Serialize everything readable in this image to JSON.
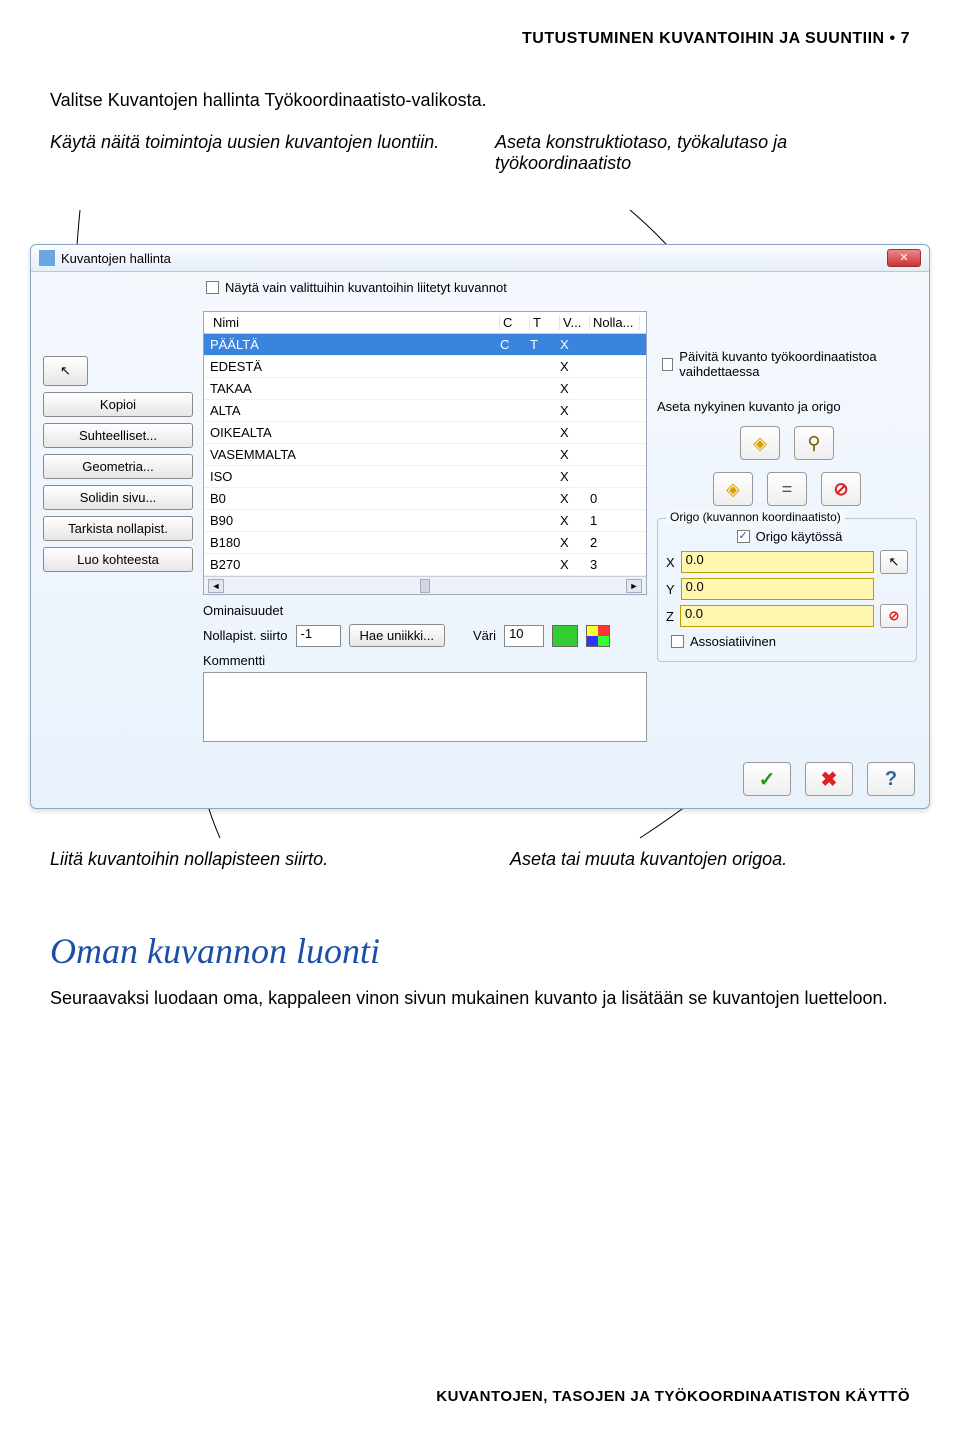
{
  "page_header": "TUTUSTUMINEN KUVANTOIHIN JA SUUNTIIN • 7",
  "intro_text": "Valitse Kuvantojen hallinta Työkoordinaa­tisto-valikosta.",
  "annot_left": "Käytä näitä toimintoja uusien kuvantojen luontiin.",
  "annot_right": "Aseta konstruktiotaso, työkalutaso ja työkoordinaatisto",
  "annot_below_left": "Liitä kuvantoihin nollapisteen siirto.",
  "annot_below_right": "Aseta tai muuta kuvantojen origoa.",
  "section_heading": "Oman kuvannon luonti",
  "section_body": "Seuraavaksi luodaan oma, kappaleen vinon sivun mukainen kuvanto ja lisätään se kuvantojen luetteloon.",
  "page_footer": "KUVANTOJEN, TASOJEN JA TYÖKOORDINAATISTON KÄYTTÖ",
  "dialog": {
    "title": "Kuvantojen hallinta",
    "top_checkbox_label": "Näytä vain valittuihin kuvantoihin liitetyt kuvannot",
    "left_buttons": [
      "Kopioi",
      "Suhteelliset...",
      "Geometria...",
      "Solidin sivu...",
      "Tarkista nollapist.",
      "Luo kohteesta"
    ],
    "arrow_glyph": "↖",
    "table": {
      "headers": [
        "Nimi",
        "C",
        "T",
        "V...",
        "Nolla..."
      ],
      "rows": [
        {
          "name": "PÄÄLTÄ",
          "c": "C",
          "t": "T",
          "v": "X",
          "n": "",
          "selected": true
        },
        {
          "name": "EDESTÄ",
          "c": "",
          "t": "",
          "v": "X",
          "n": ""
        },
        {
          "name": "TAKAA",
          "c": "",
          "t": "",
          "v": "X",
          "n": ""
        },
        {
          "name": "ALTA",
          "c": "",
          "t": "",
          "v": "X",
          "n": ""
        },
        {
          "name": "OIKEALTA",
          "c": "",
          "t": "",
          "v": "X",
          "n": ""
        },
        {
          "name": "VASEMMALTA",
          "c": "",
          "t": "",
          "v": "X",
          "n": ""
        },
        {
          "name": "ISO",
          "c": "",
          "t": "",
          "v": "X",
          "n": ""
        },
        {
          "name": "B0",
          "c": "",
          "t": "",
          "v": "X",
          "n": "0"
        },
        {
          "name": "B90",
          "c": "",
          "t": "",
          "v": "X",
          "n": "1"
        },
        {
          "name": "B180",
          "c": "",
          "t": "",
          "v": "X",
          "n": "2"
        },
        {
          "name": "B270",
          "c": "",
          "t": "",
          "v": "X",
          "n": "3"
        }
      ]
    },
    "properties": {
      "group_label": "Ominaisuudet",
      "offset_label": "Nollapist. siirto",
      "offset_value": "-1",
      "unique_button": "Hae uniikki...",
      "color_label": "Väri",
      "color_value": "10",
      "comment_label": "Kommentti"
    },
    "right": {
      "update_label": "Päivitä kuvanto työ­koordinaatistoa vaihdettaessa",
      "set_current_label": "Aseta nykyinen kuvanto ja origo",
      "icons_row1": [
        "◈",
        "⚲"
      ],
      "icons_row2": [
        "◈",
        "=",
        "⊘"
      ],
      "origin_group_title": "Origo (kuvannon koordinaatisto)",
      "origin_enabled_label": "Origo käytössä",
      "coords": {
        "x_label": "X",
        "x_value": "0.0",
        "y_label": "Y",
        "y_value": "0.0",
        "z_label": "Z",
        "z_value": "0.0"
      },
      "select_glyph": "↖",
      "deny_glyph": "⊘",
      "assoc_label": "Assosiatiivinen"
    },
    "footer": {
      "ok": "✓",
      "cancel": "✖",
      "help": "?"
    }
  }
}
